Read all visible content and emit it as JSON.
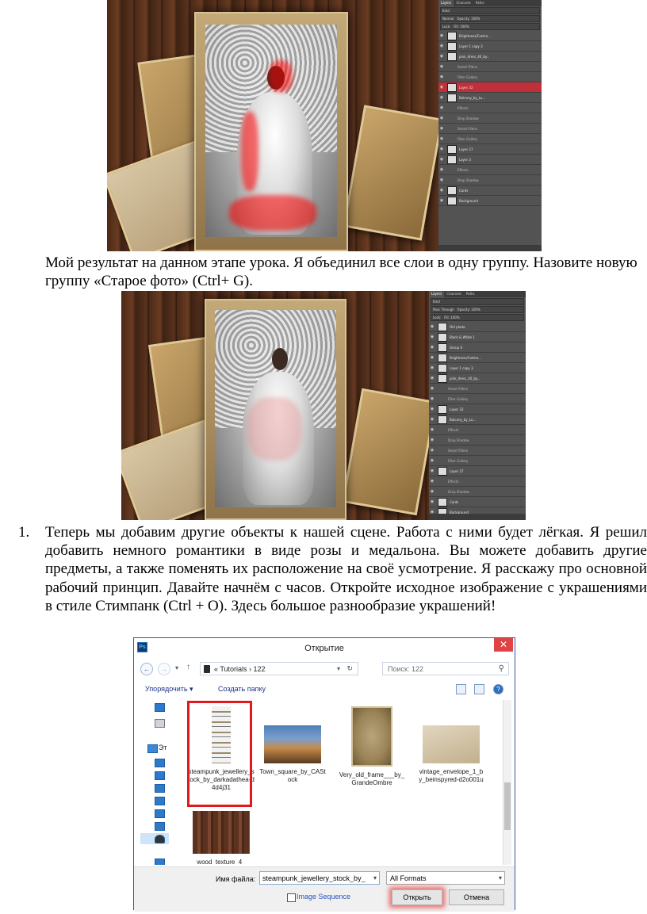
{
  "screenshot1": {
    "panel_tabs": [
      "Layers",
      "Channels",
      "Paths"
    ],
    "kind": "Kind",
    "blend": "Normal",
    "opacity_label": "Opacity:",
    "opacity": "100%",
    "lock_label": "Lock:",
    "fill_label": "Fill:",
    "fill": "100%",
    "layers": [
      "Brightness/Contra...",
      "Layer 1 copy 3",
      "pink_dress_40_by...",
      "Smart Filters",
      "Filter Gallery",
      "Layer 32",
      "Balcony_by_Lu...",
      "Effects",
      "Drop Shadow",
      "Smart Filters",
      "Filter Gallery",
      "Layer 27",
      "Layer 3",
      "Effects",
      "Drop Shadow",
      "Cards",
      "Background"
    ]
  },
  "paragraph1": "Мой результат на данном этапе урока. Я объединил все слои в одну группу. Назовите новую группу «Старое фото» (Ctrl+ G).",
  "screenshot2": {
    "panel_tabs": [
      "Layers",
      "Channels",
      "Paths"
    ],
    "kind": "Kind",
    "blend": "Pass Through",
    "opacity_label": "Opacity:",
    "opacity": "100%",
    "lock_label": "Lock:",
    "fill_label": "Fill:",
    "fill": "100%",
    "layers": [
      "Old photo",
      "Black & White 1",
      "Group 6",
      "Brightness/Contra...",
      "Layer 1 copy 3",
      "pink_dress_40_by...",
      "Smart Filters",
      "Filter Gallery",
      "Layer 32",
      "Balcony_by_Lu...",
      "Effects",
      "Drop Shadow",
      "Smart Filters",
      "Filter Gallery",
      "Layer 27",
      "Effects",
      "Drop Shadow",
      "Cards",
      "Background"
    ]
  },
  "list_number": "1.",
  "list_item_text": "Теперь мы добавим другие объекты к нашей сцене. Работа с ними будет лёгкая. Я решил добавить немного романтики в виде розы и медальона. Вы можете добавить другие предметы, а также поменять их расположение на своё усмотрение. Я расскажу про основной рабочий принцип. Давайте начнём с часов. Откройте исходное изображение с украшениями в стиле Стимпанк (Ctrl + O). Здесь большое разнообразие украшений!",
  "dialog": {
    "app_badge": "Ps",
    "title": "Открытие",
    "close": "✕",
    "path": "« Tutorials  ›  122",
    "search_placeholder": "Поиск: 122",
    "organize": "Упорядочить ▾",
    "new_folder": "Создать папку",
    "nav_label": "Эт",
    "files": [
      {
        "name": "steampunk_jewellery_stock_by_darkadathea-d4d4j31",
        "selected": true
      },
      {
        "name": "Town_square_by_CAStock",
        "selected": false
      },
      {
        "name": "Very_old_frame___by_GrandeOmbre",
        "selected": false
      },
      {
        "name": "vintage_envelope_1_by_beinspyred-d2o001u",
        "selected": false
      },
      {
        "name": "wood_texture_4_",
        "selected": false
      }
    ],
    "filename_label": "Имя файла:",
    "filename_value": "steampunk_jewellery_stock_by_",
    "format": "All Formats",
    "image_sequence": "Image Sequence",
    "open_button": "Открыть",
    "cancel_button": "Отмена"
  }
}
